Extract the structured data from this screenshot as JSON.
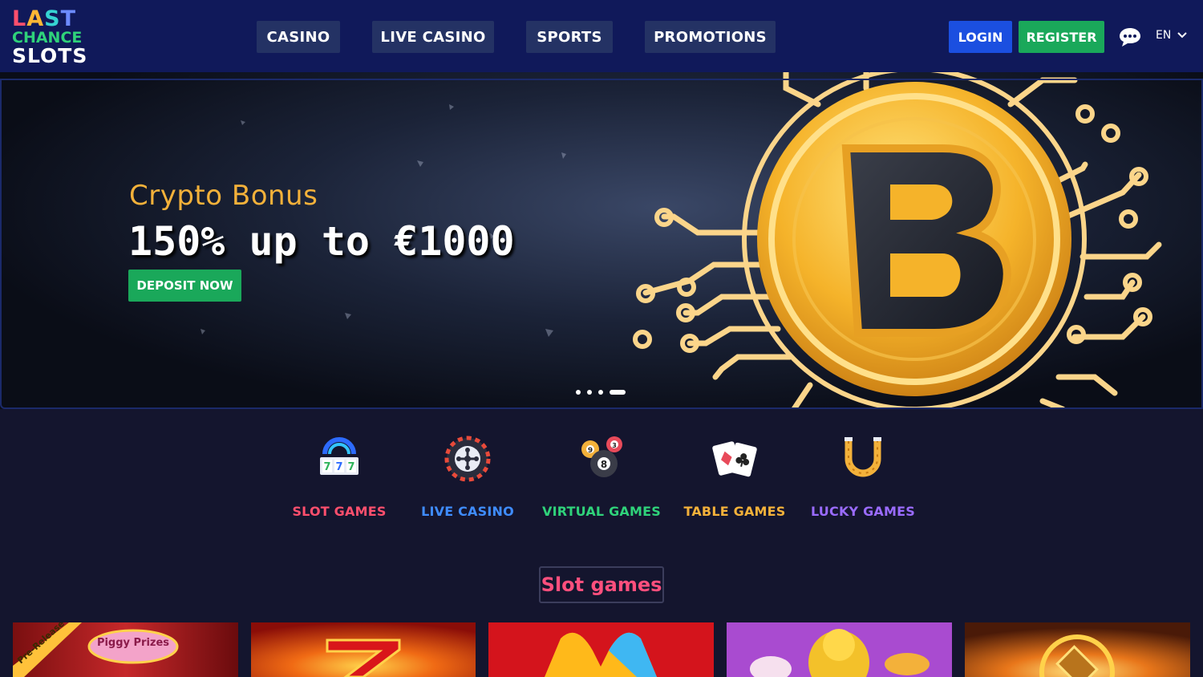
{
  "header": {
    "logo": {
      "line1": "LAST",
      "line2": "CHANCE",
      "line3": "SLOTS"
    },
    "nav": [
      {
        "label": "CASINO"
      },
      {
        "label": "LIVE CASINO"
      },
      {
        "label": "SPORTS"
      },
      {
        "label": "PROMOTIONS"
      }
    ],
    "login_label": "LOGIN",
    "register_label": "REGISTER",
    "chat_icon": "chat-bubble-icon",
    "language": "EN"
  },
  "banner": {
    "title": "Crypto Bonus",
    "amount": "150% up to €1000",
    "cta_label": "DEPOSIT NOW",
    "art_icon": "bitcoin-coin-icon",
    "slides_total": 4,
    "slide_active": 4
  },
  "categories": [
    {
      "label": "SLOT GAMES",
      "color": "#ff4f6d",
      "icon": "slot-machine-icon"
    },
    {
      "label": "LIVE CASINO",
      "color": "#3f8cff",
      "icon": "roulette-icon"
    },
    {
      "label": "VIRTUAL GAMES",
      "color": "#2fd27a",
      "icon": "billiard-balls-icon"
    },
    {
      "label": "TABLE GAMES",
      "color": "#f3b13a",
      "icon": "playing-cards-icon"
    },
    {
      "label": "LUCKY GAMES",
      "color": "#9a6bff",
      "icon": "horseshoe-icon"
    }
  ],
  "section": {
    "title": "Slot games"
  },
  "games": [
    {
      "name": "piggy-prizes-game",
      "badge": "Pre-Release",
      "logo_text": "Piggy Prizes"
    },
    {
      "name": "hot-seven-game"
    },
    {
      "name": "m-logo-game"
    },
    {
      "name": "golden-buddha-game"
    },
    {
      "name": "egypt-fire-game"
    }
  ],
  "colors": {
    "header_bg": "#10195a",
    "page_bg": "#14152e",
    "nav_btn_bg": "#243264",
    "login_bg": "#1b4fe0",
    "register_bg": "#1aa85a",
    "bonus_title": "#f3b13a",
    "section_title": "#ff4f7d"
  }
}
